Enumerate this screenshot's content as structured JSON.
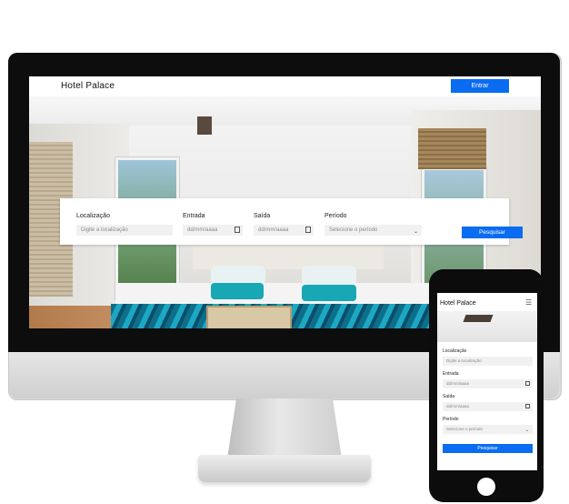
{
  "desktop": {
    "brand": "Hotel Palace",
    "login_label": "Entrar",
    "search": {
      "location_label": "Localização",
      "location_placeholder": "Digite a localização",
      "checkin_label": "Entrada",
      "checkin_placeholder": "dd/mm/aaaa",
      "checkout_label": "Saída",
      "checkout_placeholder": "dd/mm/aaaa",
      "period_label": "Período",
      "period_value": "Selecione o período",
      "submit_label": "Pesquisar"
    }
  },
  "mobile": {
    "brand": "Hotel Palace",
    "menu_icon": "☰",
    "search": {
      "location_label": "Localização",
      "location_placeholder": "Digite a localização",
      "checkin_label": "Entrada",
      "checkin_placeholder": "dd/mm/aaaa",
      "checkout_label": "Saída",
      "checkout_placeholder": "dd/mm/aaaa",
      "period_label": "Período",
      "period_value": "Selecione o período",
      "submit_label": "Pesquisar"
    }
  },
  "colors": {
    "accent": "#0a6cf0",
    "teal": "#18a7b5"
  }
}
